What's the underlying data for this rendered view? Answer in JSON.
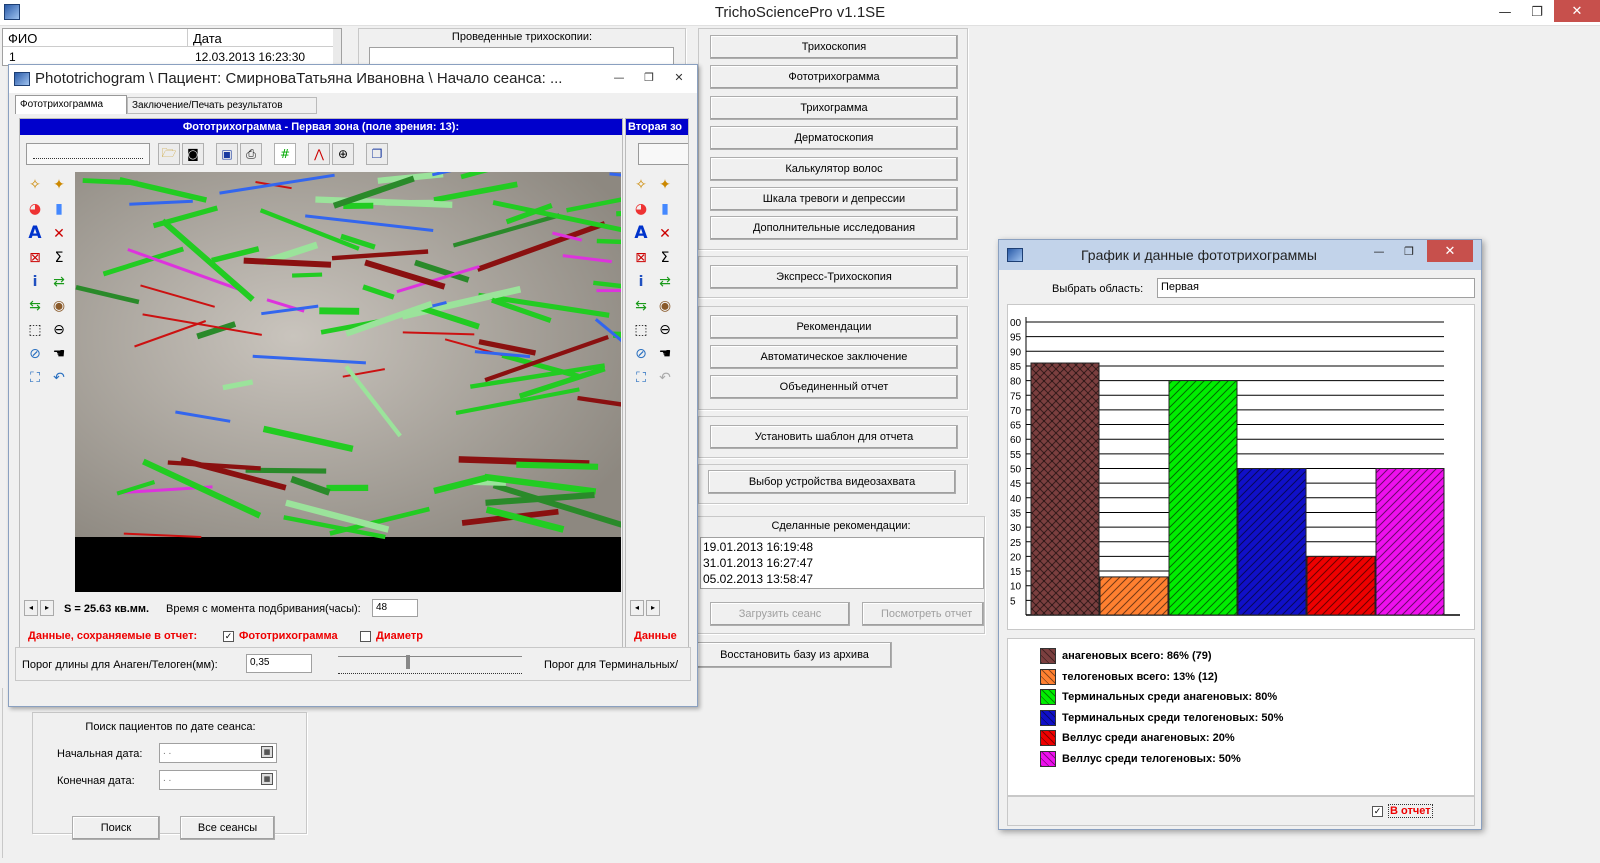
{
  "app": {
    "title": "TrichoSciencePro v1.1SE",
    "controls": {
      "minimize": "—",
      "maximize": "❐",
      "close": "✕"
    }
  },
  "patients_table": {
    "col_name": "ФИО",
    "col_date": "Дата",
    "rows": [
      {
        "name": "1",
        "date": "12.03.2013 16:23:30"
      }
    ]
  },
  "trichoscopy_group": {
    "label": "Проведенные трихоскопии:"
  },
  "main_buttons": [
    "Трихоскопия",
    "Фототрихограмма",
    "Трихограмма",
    "Дерматоскопия",
    "Калькулятор волос",
    "Шкала тревоги и депрессии",
    "Дополнительные исследования"
  ],
  "express_button": "Экспресс-Трихоскопия",
  "report_buttons": [
    "Рекомендации",
    "Автоматическое заключение",
    "Объединенный отчет"
  ],
  "template_button": "Установить шаблон для отчета",
  "capture_button": "Выбор устройства видеозахвата",
  "recommendations": {
    "label": "Сделанные рекомендации:",
    "items": [
      "19.01.2013 16:19:48",
      "31.01.2013 16:27:47",
      "05.02.2013 13:58:47"
    ],
    "load_button": "Загрузить сеанс",
    "view_button": "Посмотреть отчет"
  },
  "restore_button": "Восстановить базу из архива",
  "search": {
    "title": "Поиск пациентов по дате сеанса:",
    "start_label": "Начальная дата:",
    "end_label": "Конечная дата:",
    "start_value": ". .",
    "end_value": ". .",
    "search_button": "Поиск",
    "all_button": "Все сеансы"
  },
  "pt_window": {
    "title": "Phototrichogram \\ Пациент: СмирноваТатьяна Ивановна \\ Начало сеанса: ...",
    "tabs": [
      "Фототрихограмма",
      "Заключение/Печать результатов"
    ],
    "zone1_header": "Фототрихограмма - Первая зона (поле зрения: 13):",
    "zone2_header": "Вторая зо",
    "area_text": "S = 25.63 кв.мм.",
    "time_label": "Время с момента подбривания(часы):",
    "time_value": "48",
    "saved_label": "Данные, сохраняемые в отчет:",
    "check_pt": "Фототрихограмма",
    "check_diam": "Диаметр",
    "saved_label2": "Данные",
    "threshold_label": "Порог длины для Анаген/Телоген(мм):",
    "threshold_value": "0,35",
    "terminal_label": "Порог для Терминальных/"
  },
  "chart_window": {
    "title": "График и данные фототрихограммы",
    "area_label": "Выбрать область:",
    "area_value": "Первая",
    "report_check": "В отчет"
  },
  "chart_data": {
    "type": "bar",
    "y_ticks": [
      "00",
      "95",
      "90",
      "85",
      "80",
      "75",
      "70",
      "65",
      "60",
      "55",
      "50",
      "45",
      "40",
      "35",
      "30",
      "25",
      "20",
      "15",
      "10",
      "5"
    ],
    "ylim": [
      0,
      100
    ],
    "grid": true,
    "legend_placement": "bottom",
    "series": [
      {
        "name": "анагеновых всего: 86% (79)",
        "value": 86,
        "color": "#7b3f3f"
      },
      {
        "name": "телогеновых всего: 13% (12)",
        "value": 13,
        "color": "#ff8030"
      },
      {
        "name": "Терминальных среди анагеновых: 80%",
        "value": 80,
        "color": "#00ee00"
      },
      {
        "name": "Терминальных среди телогеновых: 50%",
        "value": 50,
        "color": "#1010c8"
      },
      {
        "name": "Веллус среди анагеновых: 20%",
        "value": 20,
        "color": "#ee0000"
      },
      {
        "name": "Веллус среди телогеновых: 50%",
        "value": 50,
        "color": "#ee10ee"
      }
    ]
  }
}
